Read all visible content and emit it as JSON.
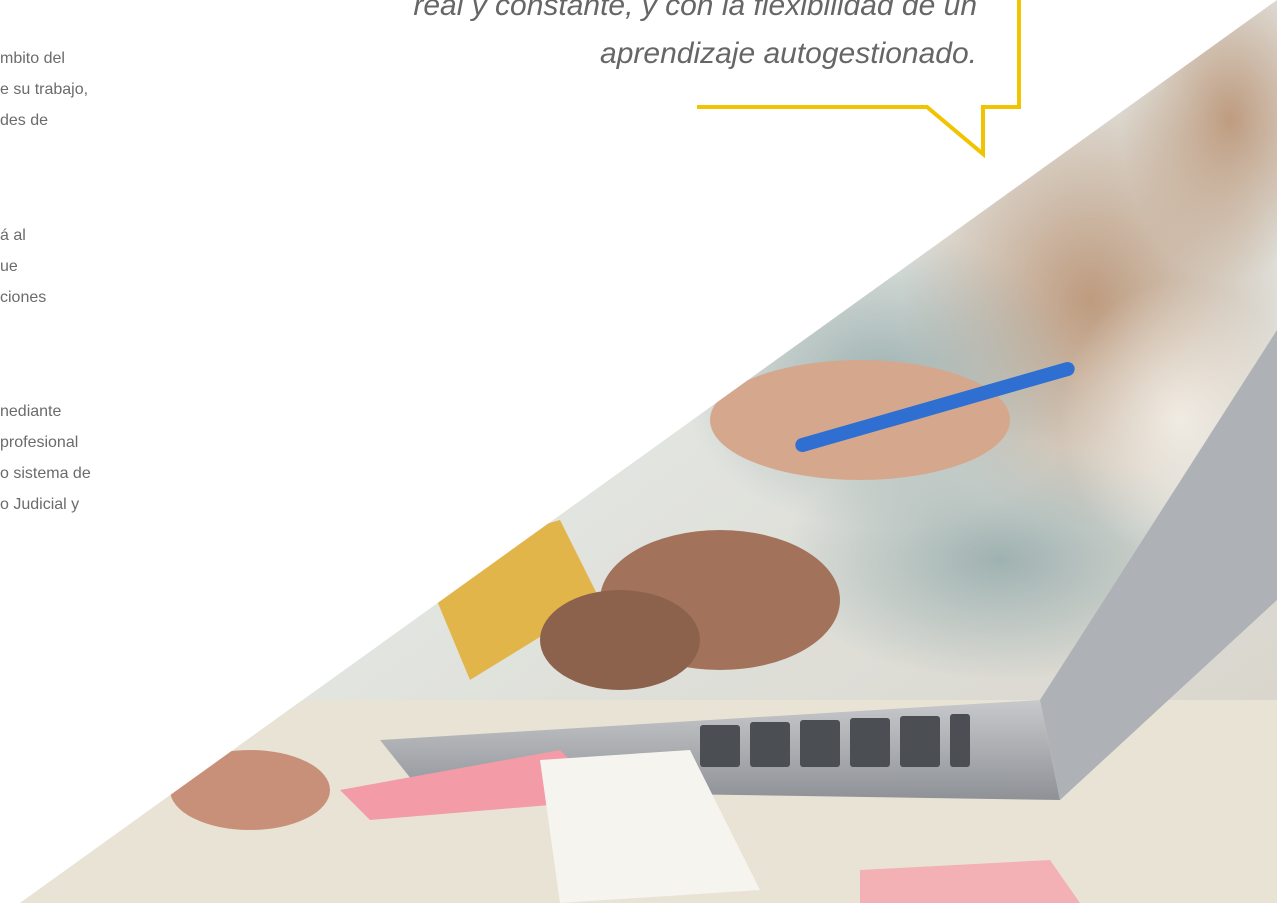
{
  "left_text": {
    "p1": [
      "mbito del",
      "e su trabajo,",
      "des de"
    ],
    "p2": [
      "á al",
      "ue",
      "ciones"
    ],
    "p3": [
      "nediante",
      "profesional",
      "o sistema de",
      "o Judicial y"
    ]
  },
  "quote": {
    "lines": [
      "real y constante, y con la flexibilidad de un",
      "aprendizaje autogestionado."
    ]
  },
  "colors": {
    "accent": "#f2c300",
    "text": "#6b6b6b"
  }
}
